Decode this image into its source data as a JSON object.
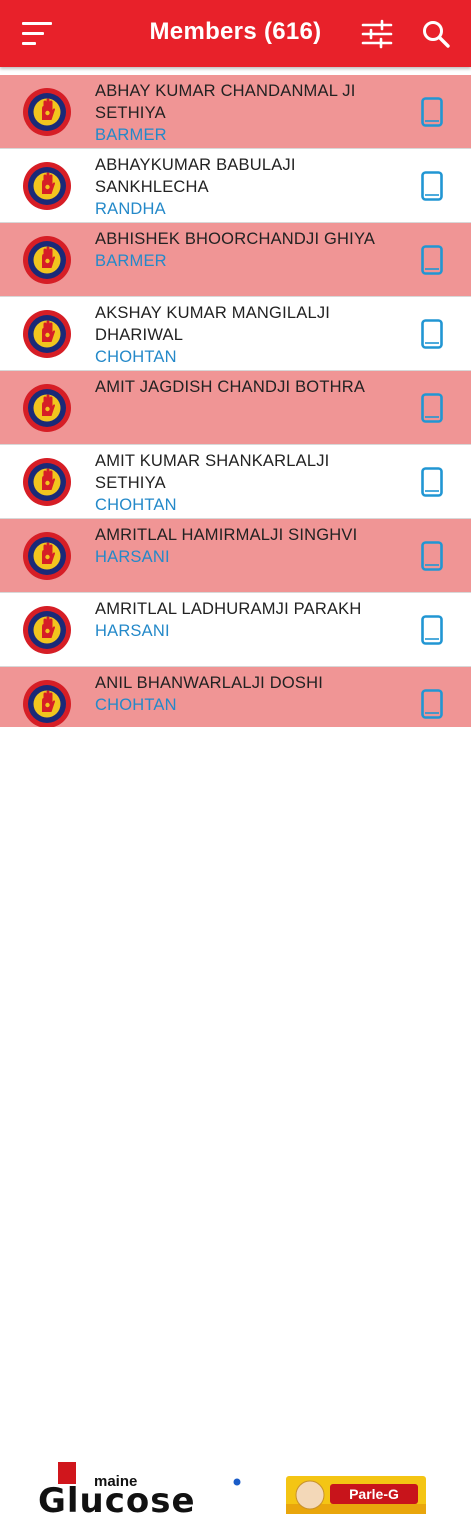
{
  "app": {
    "title": "Members (616)"
  },
  "icons": {
    "menu": "menu-icon",
    "filter": "filter-sliders-icon",
    "search": "search-icon",
    "phone": "mobile-phone-icon",
    "logo": "mahavir-international-logo"
  },
  "colors": {
    "appbar": "#e8212a",
    "pink_row": "#f09595",
    "city": "#2489c9",
    "phone_icon": "#2196d3"
  },
  "members": [
    {
      "name": "ABHAY KUMAR CHANDANMAL JI SETHIYA",
      "city": "BARMER",
      "highlight": true
    },
    {
      "name": "ABHAYKUMAR BABULAJI SANKHLECHA",
      "city": "RANDHA",
      "highlight": false
    },
    {
      "name": "ABHISHEK BHOORCHANDJI GHIYA",
      "city": "BARMER",
      "highlight": true
    },
    {
      "name": "AKSHAY KUMAR MANGILALJI DHARIWAL",
      "city": "CHOHTAN",
      "highlight": false
    },
    {
      "name": "AMIT JAGDISH CHANDJI BOTHRA",
      "city": "",
      "highlight": true
    },
    {
      "name": "AMIT KUMAR SHANKARLALJI SETHIYA",
      "city": "CHOHTAN",
      "highlight": false
    },
    {
      "name": "AMRITLAL HAMIRMALJI SINGHVI",
      "city": "HARSANI",
      "highlight": true
    },
    {
      "name": "AMRITLAL LADHURAMJI PARAKH",
      "city": "HARSANI",
      "highlight": false
    },
    {
      "name": "ANIL BHANWARLALJI DOSHI",
      "city": "CHOHTAN",
      "highlight": true
    }
  ],
  "ad": {
    "left_text_top": "maine",
    "left_text_main": "Glucose",
    "right_brand": "Parle-G"
  }
}
